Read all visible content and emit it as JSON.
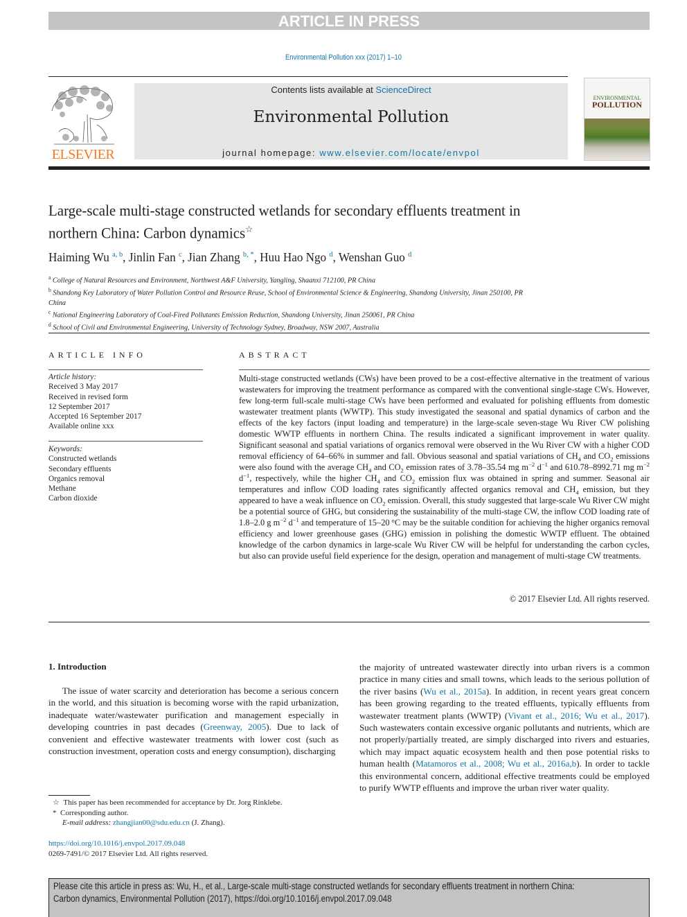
{
  "banner": "ARTICLE IN PRESS",
  "journal_citation_line": "Environmental Pollution xxx (2017) 1–10",
  "masthead": {
    "publisher_logo_text": "ELSEVIER",
    "contents_prefix": "Contents lists available at ",
    "contents_link": "ScienceDirect",
    "journal_title": "Environmental Pollution",
    "homepage_prefix": "journal homepage: ",
    "homepage_url": "www.elsevier.com/locate/envpol",
    "cover_line1": "ENVIRONMENTAL",
    "cover_line2": "POLLUTION"
  },
  "article": {
    "title": "Large-scale multi-stage constructed wetlands for secondary effluents treatment in northern China: Carbon dynamics",
    "title_mark": "☆",
    "authors": [
      {
        "name": "Haiming Wu",
        "sup": "a, b",
        "sep": ", "
      },
      {
        "name": "Jinlin Fan",
        "sup": "c",
        "sep": ", "
      },
      {
        "name": "Jian Zhang",
        "sup": "b, *",
        "sep": ", "
      },
      {
        "name": "Huu Hao Ngo",
        "sup": "d",
        "sep": ", "
      },
      {
        "name": "Wenshan Guo",
        "sup": "d",
        "sep": ""
      }
    ],
    "affiliations": [
      {
        "key": "a",
        "text": "College of Natural Resources and Environment, Northwest A&F University, Yangling, Shaanxi 712100, PR China"
      },
      {
        "key": "b",
        "text": "Shandong Key Laboratory of Water Pollution Control and Resource Reuse, School of Environmental Science & Engineering, Shandong University, Jinan 250100, PR China"
      },
      {
        "key": "c",
        "text": "National Engineering Laboratory of Coal-Fired Pollutants Emission Reduction, Shandong University, Jinan 250061, PR China"
      },
      {
        "key": "d",
        "text": "School of Civil and Environmental Engineering, University of Technology Sydney, Broadway, NSW 2007, Australia"
      }
    ]
  },
  "article_info": {
    "heading": "ARTICLE INFO",
    "history_label": "Article history:",
    "history": [
      "Received 3 May 2017",
      "Received in revised form",
      "12 September 2017",
      "Accepted 16 September 2017",
      "Available online xxx"
    ],
    "keywords_label": "Keywords:",
    "keywords": [
      "Constructed wetlands",
      "Secondary effluents",
      "Organics removal",
      "Methane",
      "Carbon dioxide"
    ]
  },
  "abstract": {
    "heading": "ABSTRACT",
    "p1": "Multi-stage constructed wetlands (CWs) have been proved to be a cost-effective alternative in the treatment of various wastewaters for improving the treatment performance as compared with the conventional single-stage CWs. However, few long-term full-scale multi-stage CWs have been performed and evaluated for polishing effluents from domestic wastewater treatment plants (WWTP). This study investigated the seasonal and spatial dynamics of carbon and the effects of the key factors (input loading and temperature) in the large-scale seven-stage Wu River CW polishing domestic WWTP effluents in northern China. The results indicated a significant improvement in water quality. Significant seasonal and spatial variations of organics removal were observed in the Wu River CW with a higher COD removal efficiency of 64–66% in summer and fall. Obvious seasonal and spatial variations of CH",
    "s1": "4",
    "p2": " and CO",
    "s2": "2",
    "p3": " emissions were also found with the average CH",
    "s3": "4",
    "p4": " and CO",
    "s4": "2",
    "p5": " emission rates of 3.78–35.54 mg m",
    "e1": "−2",
    "p6": " d",
    "e2": "−1",
    "p7": " and 610.78–8992.71 mg m",
    "e3": "−2",
    "p8": " d",
    "e4": "−1",
    "p9": ", respectively, while the higher CH",
    "s5": "4",
    "p10": " and CO",
    "s6": "2",
    "p11": " emission flux was obtained in spring and summer. Seasonal air temperatures and inflow COD loading rates significantly affected organics removal and CH",
    "s7": "4",
    "p12": " emission, but they appeared to have a weak influence on CO",
    "s8": "2",
    "p13": " emission. Overall, this study suggested that large-scale Wu River CW might be a potential source of GHG, but considering the sustainability of the multi-stage CW, the inflow COD loading rate of 1.8–2.0 g m",
    "e5": "−2",
    "p14": " d",
    "e6": "−1",
    "p15": " and temperature of 15–20 °C may be the suitable condition for achieving the higher organics removal efficiency and lower greenhouse gases (GHG) emission in polishing the domestic WWTP effluent. The obtained knowledge of the carbon dynamics in large-scale Wu River CW will be helpful for understanding the carbon cycles, but also can provide useful field experience for the design, operation and management of multi-stage CW treatments.",
    "copyright": "© 2017 Elsevier Ltd. All rights reserved."
  },
  "introduction": {
    "heading": "1.  Introduction",
    "left_a": "The issue of water scarcity and deterioration has become a serious concern in the world, and this situation is becoming worse with the rapid urbanization, inadequate water/wastewater purification and management especially in developing countries in past decades (",
    "left_link1": "Greenway, 2005",
    "left_b": "). Due to lack of convenient and effective wastewater treatments with lower cost (such as construction investment, operation costs and energy consumption), discharging",
    "right_a": "the majority of untreated wastewater directly into urban rivers is a common practice in many cities and small towns, which leads to the serious pollution of the river basins (",
    "right_link1": "Wu et al., 2015a",
    "right_b": "). In addition, in recent years great concern has been growing regarding to the treated effluents, typically effluents from wastewater treatment plants (WWTP) (",
    "right_link2": "Vivant et al., 2016; Wu et al., 2017",
    "right_c": "). Such wastewaters contain excessive organic pollutants and nutrients, which are not properly/partially treated, are simply discharged into rivers and estuaries, which may impact aquatic ecosystem health and then pose potential risks to human health (",
    "right_link3": "Matamoros et al., 2008; Wu et al., 2016a,b",
    "right_d": "). In order to tackle this environmental concern, additional effective treatments could be employed to purify WWTP effluents and improve the urban river water quality."
  },
  "footnotes": {
    "star_mark": "☆",
    "star_text": "This paper has been recommended for acceptance by Dr. Jorg Rinklebe.",
    "corr_mark": "*",
    "corr_text": "Corresponding author.",
    "email_label": "E-mail address:",
    "email": "zhangjian00@sdu.edu.cn",
    "email_suffix": " (J. Zhang).",
    "doi": "https://doi.org/10.1016/j.envpol.2017.09.048",
    "issn": "0269-7491/© 2017 Elsevier Ltd. All rights reserved."
  },
  "cite_box": {
    "text": "Please cite this article in press as: Wu, H., et al., Large-scale multi-stage constructed wetlands for secondary effluents treatment in northern China: Carbon dynamics, Environmental Pollution (2017), https://doi.org/10.1016/j.envpol.2017.09.048"
  },
  "colors": {
    "link": "#0f75a8",
    "elsevier_orange": "#f47a20",
    "banner_gray": "#c3c3c3"
  }
}
